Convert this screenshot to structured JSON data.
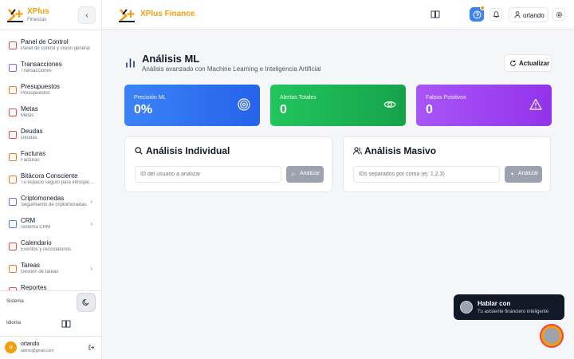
{
  "brand": {
    "name": "XPlus",
    "subtitle": "Finanzas",
    "top_name_a": "XPlus",
    "top_name_b": "Finance"
  },
  "sidebar": {
    "collapse_icon": "chevron-left-icon",
    "items": [
      {
        "label": "Panel de Control",
        "sub": "Panel de control y visión general",
        "icon": "dashboard-icon",
        "color": "#ef4444",
        "chevron": false
      },
      {
        "label": "Transacciones",
        "sub": "Transacciones",
        "icon": "transactions-icon",
        "color": "#8b5cf6",
        "chevron": false
      },
      {
        "label": "Presupuestos",
        "sub": "Presupuestos",
        "icon": "budget-icon",
        "color": "#f97316",
        "chevron": false
      },
      {
        "label": "Metas",
        "sub": "Metas",
        "icon": "goals-icon",
        "color": "#ef4444",
        "chevron": false
      },
      {
        "label": "Deudas",
        "sub": "Deudas",
        "icon": "debts-icon",
        "color": "#ef4444",
        "chevron": false
      },
      {
        "label": "Facturas",
        "sub": "Facturas",
        "icon": "invoices-icon",
        "color": "#f97316",
        "chevron": false
      },
      {
        "label": "Bitácora Consciente",
        "sub": "Tu espacio seguro para introspección",
        "icon": "journal-icon",
        "color": "#f97316",
        "chevron": false
      },
      {
        "label": "Criptomonedas",
        "sub": "Seguimiento de criptomonedas",
        "icon": "crypto-icon",
        "color": "#8b5cf6",
        "chevron": true
      },
      {
        "label": "CRM",
        "sub": "Sistema CRM",
        "icon": "crm-icon",
        "color": "#3b82f6",
        "chevron": true
      },
      {
        "label": "Calendario",
        "sub": "Eventos y recordatorios",
        "icon": "calendar-icon",
        "color": "#ef4444",
        "chevron": false
      },
      {
        "label": "Tareas",
        "sub": "Gestión de tareas",
        "icon": "tasks-icon",
        "color": "#f97316",
        "chevron": true
      },
      {
        "label": "Reportes",
        "sub": "",
        "icon": "reports-icon",
        "color": "#ef4444",
        "chevron": false
      }
    ],
    "system_label": "Sistema",
    "language_label": "Idioma",
    "user": {
      "initial": "o",
      "name": "orlando",
      "email": "admin@gmail.com"
    }
  },
  "topbar": {
    "user_label": "orlando"
  },
  "main": {
    "title": "Análisis ML",
    "subtitle": "Análisis avanzado con Machine Learning e Inteligencia Artificial",
    "refresh_label": "Actualizar",
    "stats": [
      {
        "label": "Precisión ML",
        "value": "0%",
        "icon": "target-icon"
      },
      {
        "label": "Alertas Totales",
        "value": "0",
        "icon": "eye-icon"
      },
      {
        "label": "Falsos Positivos",
        "value": "0",
        "icon": "warning-icon"
      }
    ],
    "individual": {
      "title": "Análisis Individual",
      "placeholder": "ID del usuario a analizar",
      "button": "Analizar"
    },
    "bulk": {
      "title": "Análisis Masivo",
      "placeholder": "IDs separados por coma (ej: 1,2,3)",
      "button": "Analizar"
    }
  },
  "chat": {
    "title": "Hablar con",
    "subtitle": "Tu asistente financiero inteligente"
  },
  "colors": {
    "accent": "#f59e0b",
    "primary": "#3b82f6",
    "success": "#22c55e",
    "purple": "#a855f7"
  }
}
